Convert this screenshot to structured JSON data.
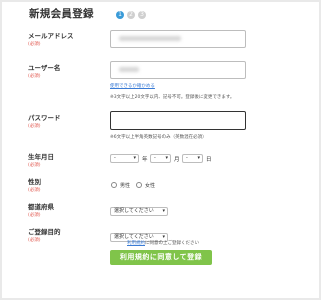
{
  "header": {
    "title": "新規会員登録",
    "steps": [
      "1",
      "2",
      "3"
    ]
  },
  "form": {
    "email": {
      "label": "メールアドレス",
      "badge": "(必須)"
    },
    "username": {
      "label": "ユーザー名",
      "badge": "(必須)",
      "link": "使用できるか確かめる",
      "note": "※3文字以上20文字以内、記号不可。登録後に変更できます。"
    },
    "password": {
      "label": "パスワード",
      "badge": "(必須)",
      "note": "※6文字以上半角英数記号のみ（英数混在必須）"
    },
    "birthday": {
      "label": "生年月日",
      "badge": "(必須)",
      "year_value": "-",
      "month_value": "-",
      "day_value": "-",
      "year_unit": "年",
      "month_unit": "月",
      "day_unit": "日"
    },
    "gender": {
      "label": "性別",
      "badge": "(必須)",
      "male": "男性",
      "female": "女性"
    },
    "prefecture": {
      "label": "都道府県",
      "badge": "(必須)",
      "value": "選択してください"
    },
    "purpose": {
      "label": "ご登録目的",
      "badge": "(必須)",
      "value": "選択してください"
    },
    "terms": {
      "link": "利用規約",
      "text": "に同意の上ご登録ください"
    },
    "submit_label": "利用規約に同意して登録"
  },
  "icons": {
    "dropdown": "chevron-down-icon"
  },
  "colors": {
    "accent": "#3a9bd8",
    "submit": "#80c44a",
    "required": "#e0534a",
    "link": "#3a7bd5"
  }
}
